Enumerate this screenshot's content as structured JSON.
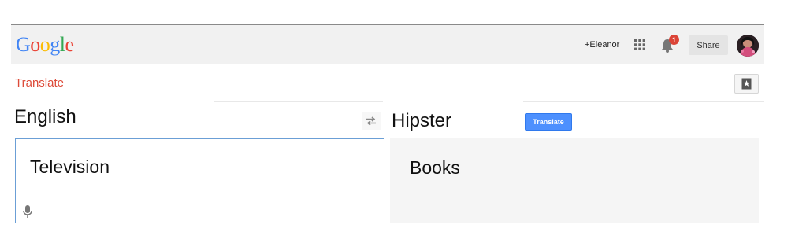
{
  "header": {
    "logo_text": "Google",
    "user_link": "+Eleanor",
    "notification_count": "1",
    "share_label": "Share"
  },
  "app": {
    "title": "Translate"
  },
  "source": {
    "language": "English",
    "text": "Television"
  },
  "target": {
    "language": "Hipster",
    "text": "Books"
  },
  "translate_button": "Translate",
  "colors": {
    "logo": [
      "#4285f4",
      "#ea4335",
      "#fbbc05",
      "#4285f4",
      "#34a853",
      "#ea4335"
    ],
    "title": "#dd4b39",
    "badge": "#db4437",
    "primary_button": "#4d90fe",
    "input_border": "#6b9fd6"
  },
  "icons": [
    "apps-grid-icon",
    "bell-icon",
    "avatar",
    "bookmark-star-icon",
    "swap-arrows-icon",
    "microphone-icon"
  ]
}
